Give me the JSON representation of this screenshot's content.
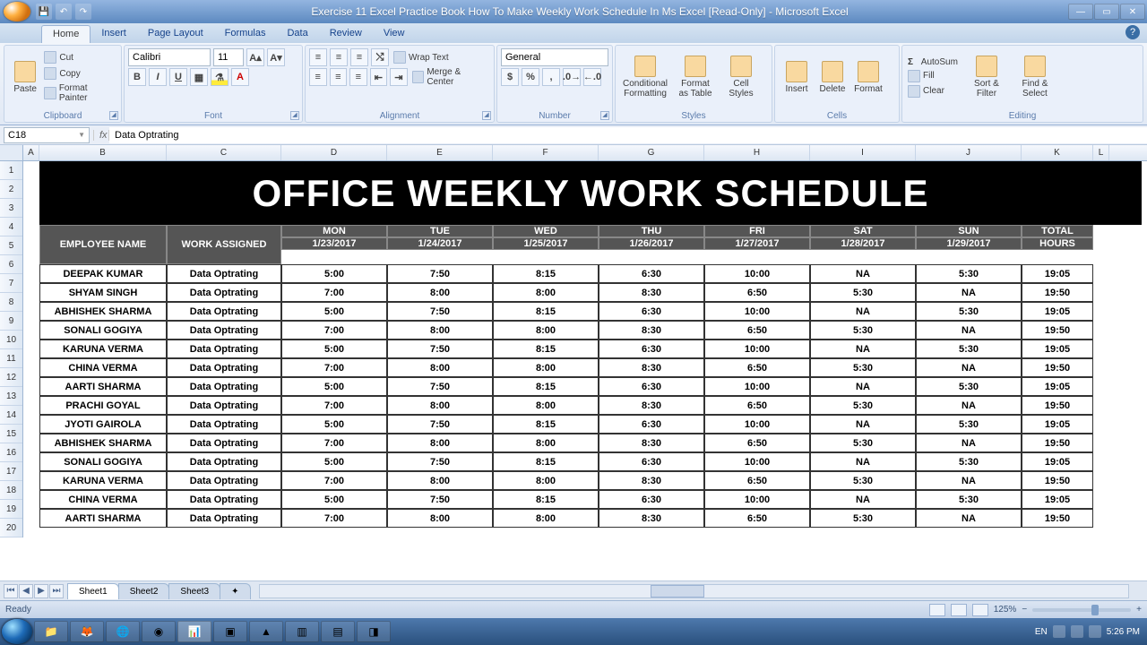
{
  "window": {
    "title": "Exercise 11  Excel Practice Book  How To Make Weekly Work Schedule In Ms Excel  [Read-Only] - Microsoft Excel"
  },
  "ribbon": {
    "tabs": [
      "Home",
      "Insert",
      "Page Layout",
      "Formulas",
      "Data",
      "Review",
      "View"
    ],
    "active_tab": "Home",
    "clipboard": {
      "paste": "Paste",
      "cut": "Cut",
      "copy": "Copy",
      "fp": "Format Painter",
      "label": "Clipboard"
    },
    "font": {
      "name": "Calibri",
      "size": "11",
      "label": "Font"
    },
    "alignment": {
      "wrap": "Wrap Text",
      "merge": "Merge & Center",
      "label": "Alignment"
    },
    "number": {
      "format": "General",
      "label": "Number"
    },
    "styles": {
      "cf": "Conditional\nFormatting",
      "fat": "Format\nas Table",
      "cs": "Cell\nStyles",
      "label": "Styles"
    },
    "cells": {
      "insert": "Insert",
      "delete": "Delete",
      "format": "Format",
      "label": "Cells"
    },
    "editing": {
      "autosum": "AutoSum",
      "fill": "Fill",
      "clear": "Clear",
      "sort": "Sort &\nFilter",
      "find": "Find &\nSelect",
      "label": "Editing"
    }
  },
  "formula_bar": {
    "namebox": "C18",
    "value": "Data Optrating"
  },
  "columns": [
    "A",
    "B",
    "C",
    "D",
    "E",
    "F",
    "G",
    "H",
    "I",
    "J",
    "K",
    "L"
  ],
  "rows": [
    "1",
    "2",
    "3",
    "4",
    "5",
    "6",
    "7",
    "8",
    "9",
    "10",
    "11",
    "12",
    "13",
    "14",
    "15",
    "16",
    "17",
    "18",
    "19",
    "20"
  ],
  "schedule": {
    "title": "OFFICE WEEKLY WORK SCHEDULE",
    "headers": {
      "emp": "EMPLOYEE NAME",
      "work": "WORK ASSIGNED",
      "days": [
        "MON",
        "TUE",
        "WED",
        "THU",
        "FRI",
        "SAT",
        "SUN"
      ],
      "dates": [
        "1/23/2017",
        "1/24/2017",
        "1/25/2017",
        "1/26/2017",
        "1/27/2017",
        "1/28/2017",
        "1/29/2017"
      ],
      "total": "TOTAL",
      "hours": "HOURS"
    },
    "rows": [
      {
        "emp": "DEEPAK KUMAR",
        "work": "Data Optrating",
        "d": [
          "5:00",
          "7:50",
          "8:15",
          "6:30",
          "10:00",
          "NA",
          "5:30"
        ],
        "total": "19:05"
      },
      {
        "emp": "SHYAM SINGH",
        "work": "Data Optrating",
        "d": [
          "7:00",
          "8:00",
          "8:00",
          "8:30",
          "6:50",
          "5:30",
          "NA"
        ],
        "total": "19:50"
      },
      {
        "emp": "ABHISHEK SHARMA",
        "work": "Data Optrating",
        "d": [
          "5:00",
          "7:50",
          "8:15",
          "6:30",
          "10:00",
          "NA",
          "5:30"
        ],
        "total": "19:05"
      },
      {
        "emp": "SONALI GOGIYA",
        "work": "Data Optrating",
        "d": [
          "7:00",
          "8:00",
          "8:00",
          "8:30",
          "6:50",
          "5:30",
          "NA"
        ],
        "total": "19:50"
      },
      {
        "emp": "KARUNA VERMA",
        "work": "Data Optrating",
        "d": [
          "5:00",
          "7:50",
          "8:15",
          "6:30",
          "10:00",
          "NA",
          "5:30"
        ],
        "total": "19:05"
      },
      {
        "emp": "CHINA VERMA",
        "work": "Data Optrating",
        "d": [
          "7:00",
          "8:00",
          "8:00",
          "8:30",
          "6:50",
          "5:30",
          "NA"
        ],
        "total": "19:50"
      },
      {
        "emp": "AARTI SHARMA",
        "work": "Data Optrating",
        "d": [
          "5:00",
          "7:50",
          "8:15",
          "6:30",
          "10:00",
          "NA",
          "5:30"
        ],
        "total": "19:05"
      },
      {
        "emp": "PRACHI GOYAL",
        "work": "Data Optrating",
        "d": [
          "7:00",
          "8:00",
          "8:00",
          "8:30",
          "6:50",
          "5:30",
          "NA"
        ],
        "total": "19:50"
      },
      {
        "emp": "JYOTI GAIROLA",
        "work": "Data Optrating",
        "d": [
          "5:00",
          "7:50",
          "8:15",
          "6:30",
          "10:00",
          "NA",
          "5:30"
        ],
        "total": "19:05"
      },
      {
        "emp": "ABHISHEK SHARMA",
        "work": "Data Optrating",
        "d": [
          "7:00",
          "8:00",
          "8:00",
          "8:30",
          "6:50",
          "5:30",
          "NA"
        ],
        "total": "19:50"
      },
      {
        "emp": "SONALI GOGIYA",
        "work": "Data Optrating",
        "d": [
          "5:00",
          "7:50",
          "8:15",
          "6:30",
          "10:00",
          "NA",
          "5:30"
        ],
        "total": "19:05"
      },
      {
        "emp": "KARUNA VERMA",
        "work": "Data Optrating",
        "d": [
          "7:00",
          "8:00",
          "8:00",
          "8:30",
          "6:50",
          "5:30",
          "NA"
        ],
        "total": "19:50"
      },
      {
        "emp": "CHINA VERMA",
        "work": "Data Optrating",
        "d": [
          "5:00",
          "7:50",
          "8:15",
          "6:30",
          "10:00",
          "NA",
          "5:30"
        ],
        "total": "19:05"
      },
      {
        "emp": "AARTI SHARMA",
        "work": "Data Optrating",
        "d": [
          "7:00",
          "8:00",
          "8:00",
          "8:30",
          "6:50",
          "5:30",
          "NA"
        ],
        "total": "19:50"
      }
    ]
  },
  "sheets": [
    "Sheet1",
    "Sheet2",
    "Sheet3"
  ],
  "status": {
    "ready": "Ready",
    "lang": "EN",
    "zoom": "125%",
    "time": "5:26 PM"
  }
}
